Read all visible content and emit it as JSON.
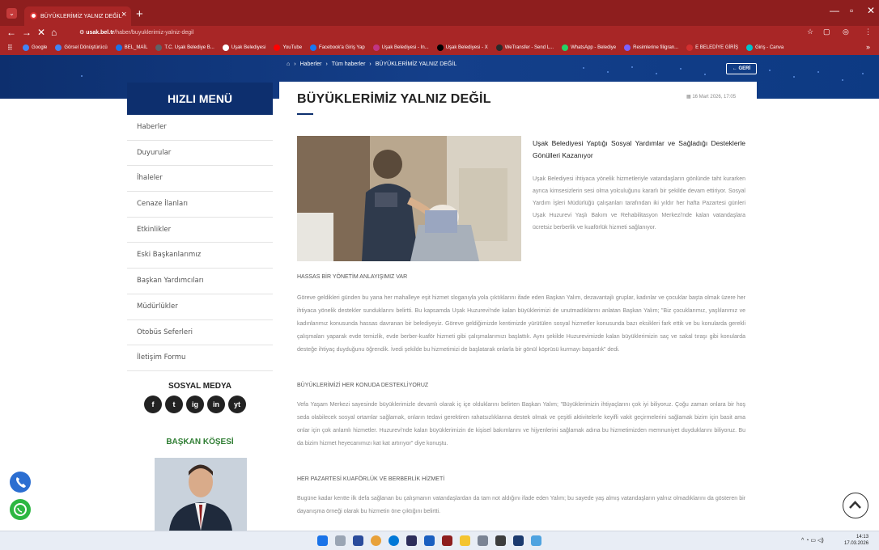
{
  "browser": {
    "tab_title": "BÜYÜKLERİMİZ YALNIZ DEĞİL",
    "tab_close": "×",
    "new_tab": "+",
    "url_domain": "usak.bel.tr",
    "url_path": "/haber/buyuklerimiz-yalniz-degil",
    "bookmarks": [
      {
        "label": "Google",
        "color": "#4285f4"
      },
      {
        "label": "Görsel Dönüştürücü",
        "color": "#4285f4"
      },
      {
        "label": "BEL_MAİL",
        "color": "#1a73e8"
      },
      {
        "label": "T.C. Uşak Belediye B...",
        "color": "#5f6368"
      },
      {
        "label": "Uşak Belediyesi",
        "color": "#ffffff"
      },
      {
        "label": "YouTube",
        "color": "#ff0000"
      },
      {
        "label": "Facebook'a Giriş Yap",
        "color": "#1877f2"
      },
      {
        "label": "Uşak Belediyesi - In...",
        "color": "#c13584"
      },
      {
        "label": "Uşak Belediyesi - X",
        "color": "#000000"
      },
      {
        "label": "WeTransfer - Send L...",
        "color": "#2a2a2a"
      },
      {
        "label": "WhatsApp - Belediye",
        "color": "#25d366"
      },
      {
        "label": "Resimlerine filigran...",
        "color": "#7b61ff"
      },
      {
        "label": "E BELEDİYE GİRİŞ",
        "color": "#d32f2f"
      },
      {
        "label": "Giriş - Canva",
        "color": "#00c4cc"
      }
    ],
    "bm_more": "»"
  },
  "breadcrumb": {
    "home_icon": "home-icon",
    "items": [
      "Haberler",
      "Tüm haberler",
      "BÜYÜKLERİMİZ YALNIZ DEĞİL"
    ],
    "sep": "›"
  },
  "back_button": "← GERİ",
  "sidebar": {
    "title": "HIZLI MENÜ",
    "items": [
      "Haberler",
      "Duyurular",
      "İhaleler",
      "Cenaze İlanları",
      "Etkinlikler",
      "Eski Başkanlarımız",
      "Başkan Yardımcıları",
      "Müdürlükler",
      "Otobüs Seferleri",
      "İletişim Formu"
    ],
    "social_title": "SOSYAL MEDYA",
    "social": [
      "f",
      "t",
      "ig",
      "in",
      "yt"
    ],
    "mayor_title": "BAŞKAN KÖŞESİ"
  },
  "article": {
    "title": "BÜYÜKLERİMİZ YALNIZ DEĞİL",
    "date": "16 Mart 2026, 17:05",
    "subhead": "Uşak Belediyesi Yaptığı Sosyal Yardımlar ve Sağladığı Desteklerle Gönülleri Kazanıyor",
    "intro": "Uşak Belediyesi ihtiyaca yönelik hizmetleriyle vatandaşların gönlünde taht kurarken ayrıca kimsesizlerin sesi olma yolculuğunu kararlı bir şekilde devam ettiriyor. Sosyal Yardım İşleri Müdürlüğü çalışanları tarafından iki yıldır her hafta Pazartesi günleri Uşak Huzurevi Yaşlı Bakım ve Rehabilitasyon Merkezi'nde kalan vatandaşlara ücretsiz berberlik ve kuaförlük hizmeti sağlanıyor.",
    "sections": [
      {
        "heading": "HASSAS BİR YÖNETİM ANLAYIŞIMIZ VAR",
        "text": "Göreve geldikleri günden bu yana her mahalleye eşit hizmet sloganıyla yola çıktıklarını ifade eden Başkan Yalım, dezavantajlı gruplar, kadınlar ve çocuklar başta olmak üzere her ihtiyaca yönelik destekler sunduklarını belirtti. Bu kapsamda Uşak Huzurevi'nde kalan büyüklerimizi de unutmadıklarını anlatan Başkan Yalım; \"Biz çocuklarımız, yaşlılarımız ve kadınlarımız konusunda hassas davranan bir belediyeyiz. Göreve geldiğimizde kentimizde yürütülen sosyal hizmetler konusunda bazı eksikleri fark ettik ve bu konularda gerekli çalışmaları yaparak evde temizlik, evde berber-kuaför hizmeti gibi çalışmalarımızı başlattık. Aynı şekilde Huzurevimizde kalan büyüklerimizin saç ve sakal tıraşı gibi konularda desteğe ihtiyaç duyduğunu öğrendik. İvedi şekilde bu hizmetimizi de başlatarak onlarla bir gönül köprüsü kurmayı başardık\" dedi."
      },
      {
        "heading": "BÜYÜKLERİMİZİ HER KONUDA DESTEKLİYORUZ",
        "text": "Vefa Yaşam Merkezi sayesinde büyüklerimizle devamlı olarak iç içe olduklarını belirten Başkan Yalım; \"Büyüklerimizin ihtiyaçlarını çok iyi biliyoruz. Çoğu zaman onlara bir hoş seda olabilecek sosyal ortamlar sağlamak, onların tedavi gerektiren rahatsızlıklarına destek olmak ve çeşitli aktivitelerle keyifli vakit geçirmelerini sağlamak bizim için basit ama onlar için çok anlamlı hizmetler. Huzurevi'nde kalan büyüklerimizin de kişisel bakımlarını ve hijyenlerini sağlamak adına bu hizmetimizden memnuniyet duyduklarını biliyoruz. Bu da bizim hizmet heyecanımızı kat kat artırıyor\" diye konuştu."
      },
      {
        "heading": "HER PAZARTESİ KUAFÖRLÜK VE BERBERLİK HİZMETİ",
        "text": "Bugüne kadar kentte ilk defa sağlanan bu çalışmanın vatandaşlardan da tam not aldığını ifade eden Yalım; bu sayede yaş almış vatandaşların yalnız olmadıklarını da gösteren bir dayanışma örneği olarak bu hizmetin öne çıktığını belirtti."
      }
    ]
  },
  "taskbar": {
    "time": "14:13",
    "date": "17.03.2026"
  },
  "colors": {
    "brand_dark": "#0d2f6e",
    "browser_red": "#8e1e1e",
    "accent_green": "#2e7d32"
  }
}
